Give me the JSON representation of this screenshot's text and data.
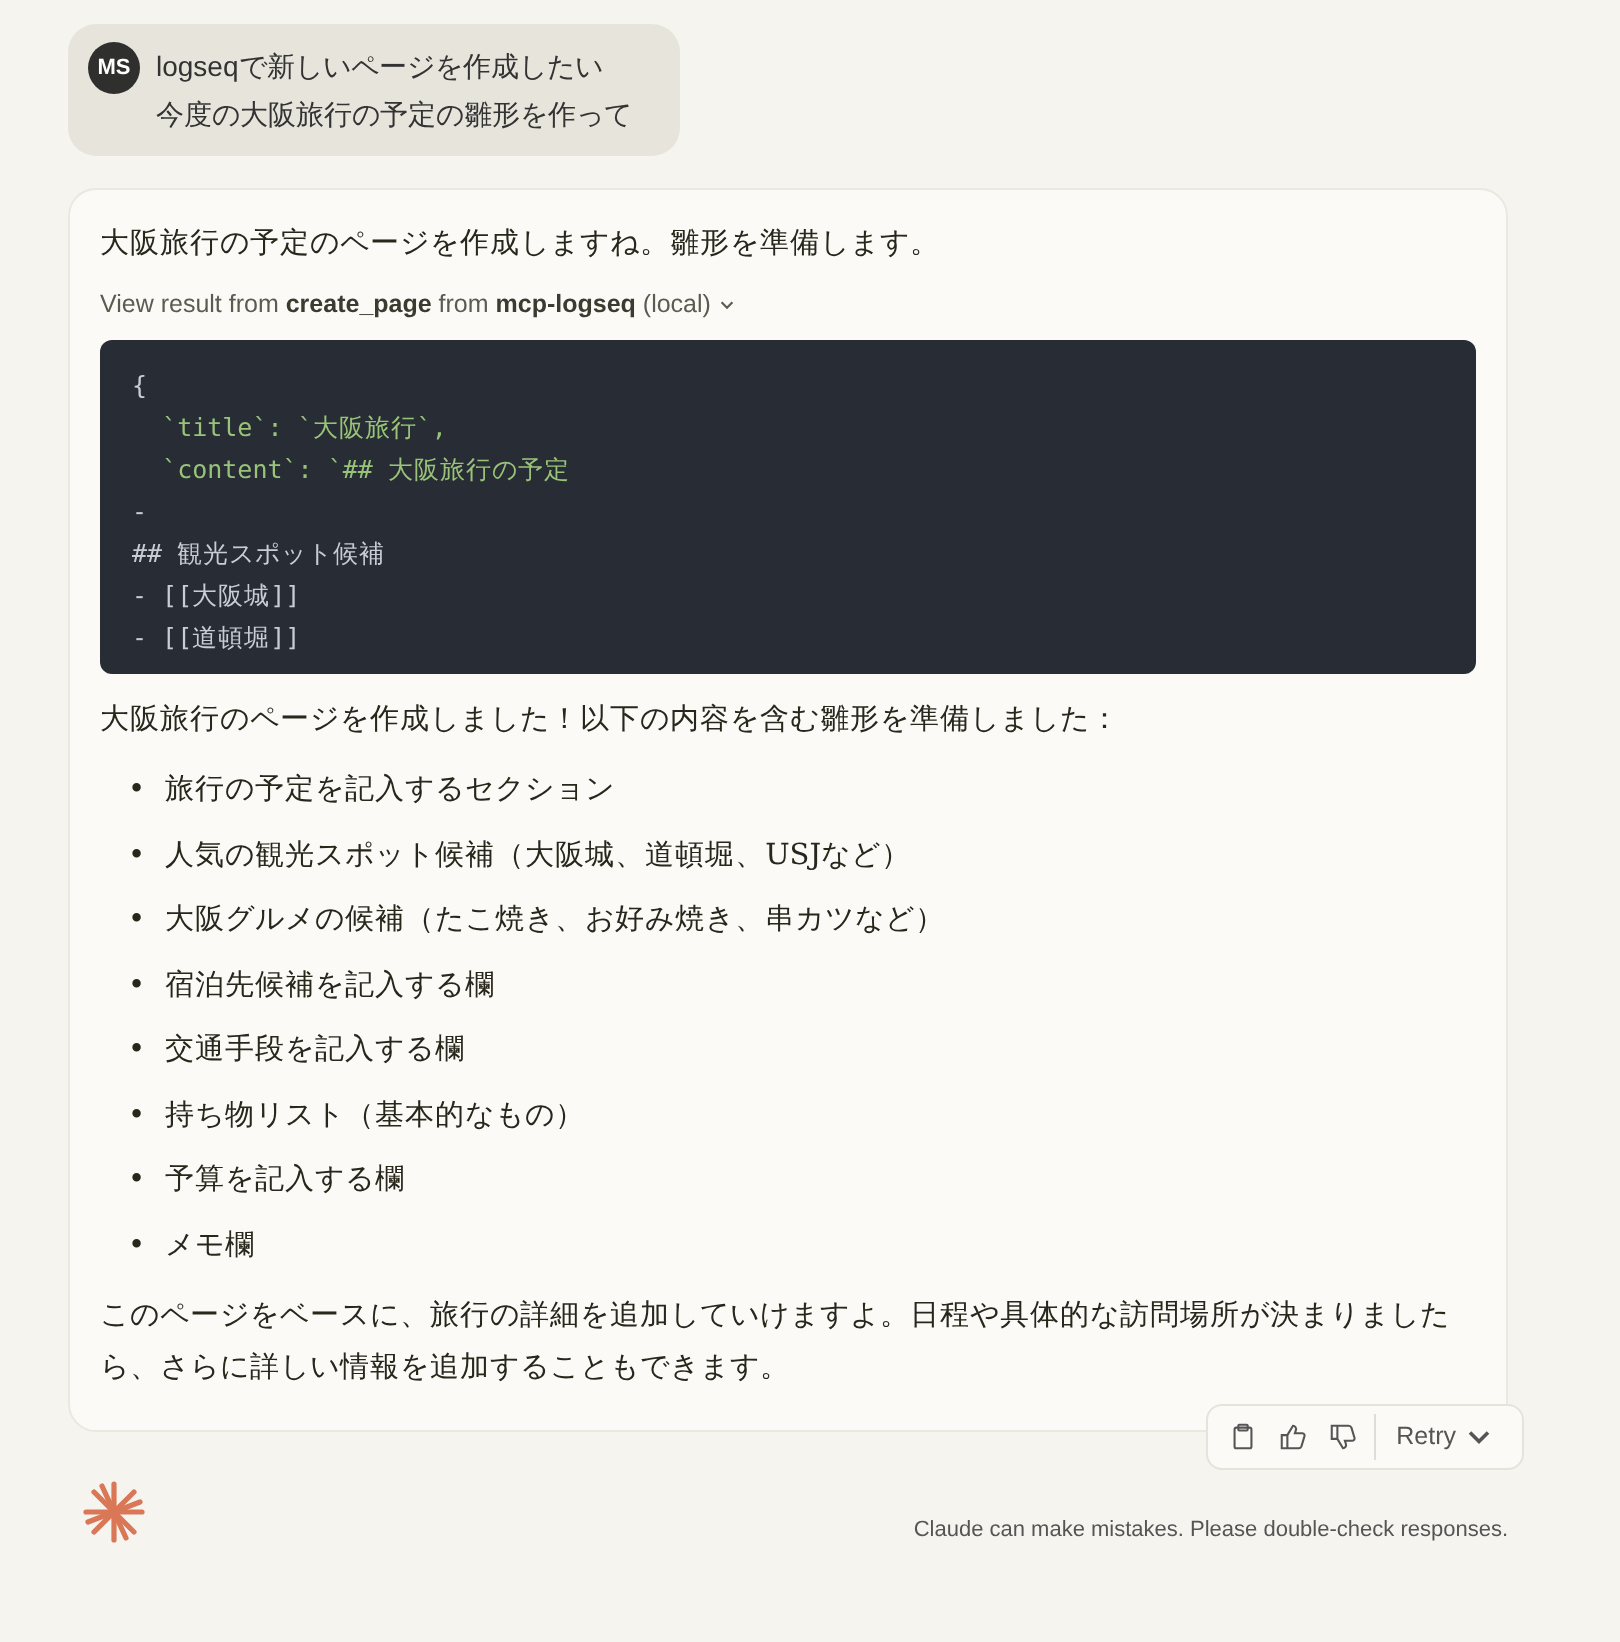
{
  "user_message": {
    "avatar": "MS",
    "lines": [
      "logseqで新しいページを作成したい",
      "今度の大阪旅行の予定の雛形を作って"
    ]
  },
  "assistant_message": {
    "intro": "大阪旅行の予定のページを作成しますね。雛形を準備します。",
    "tool_result": {
      "text": "View result from **create_page** from **mcp-logseq** (local)",
      "expanded": false
    },
    "code_lines": [
      {
        "kind": "plain",
        "text": "{"
      },
      {
        "kind": "string",
        "text": "  `title`: `大阪旅行`,"
      },
      {
        "kind": "string",
        "text": "  `content`: `## 大阪旅行の予定"
      },
      {
        "kind": "plain",
        "text": "-"
      },
      {
        "kind": "plain",
        "text": "## 観光スポット候補"
      },
      {
        "kind": "plain",
        "text": "- [[大阪城]]"
      },
      {
        "kind": "plain",
        "text": "- [[道頓堀]]"
      }
    ],
    "summary": "大阪旅行のページを作成しました！以下の内容を含む雛形を準備しました：",
    "bullets": [
      {
        "marker": "•",
        "text": "旅行の予定を記入するセクション"
      },
      {
        "marker": "•",
        "text": "人気の観光スポット候補（大阪城、道頓堀、USJなど）"
      },
      {
        "marker": "•",
        "text": "大阪グルメの候補（たこ焼き、お好み焼き、串カツなど）"
      },
      {
        "marker": "•",
        "text": "宿泊先候補を記入する欄"
      },
      {
        "marker": "•",
        "text": "交通手段を記入する欄"
      },
      {
        "marker": "•",
        "text": "持ち物リスト（基本的なもの）"
      },
      {
        "marker": "•",
        "text": "予算を記入する欄"
      },
      {
        "marker": "•",
        "text": "メモ欄"
      }
    ],
    "closing": "このページをベースに、旅行の詳細を追加していけますよ。日程や具体的な訪問場所が決まりましたら、さらに詳しい情報を追加することもできます。"
  },
  "actions": {
    "retry": "Retry"
  },
  "disclaimer": "Claude can make mistakes. Please double-check responses."
}
